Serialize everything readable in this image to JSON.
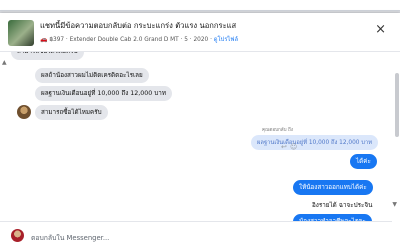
{
  "top_strip_text": "",
  "header": {
    "title": "แชทนี้มีข้อความตอบกลับต่อ กระบะแกร่ง ตัวแรง นอกกระแส",
    "car_marker": "🚗",
    "subtitle_main": "฿397 · Extender Double Cab 2.0 Grand D MT · ",
    "subtitle_dot": "5 · 2020 · ",
    "subtitle_link": "ดูโปรไฟล์",
    "close_symbol": "×"
  },
  "scroll": {
    "up": "▲",
    "down": "▼"
  },
  "messages": {
    "m0": "สามารถซื้อได้ไหมครับ",
    "m1": "ผลถ้าน้องสาวผมไม่ติดเครดิตอะไรเลย",
    "m2": "ผลฐานเงินเดือนอยู่ที่ 10,000 ถึง 12,000 บาท",
    "m3": "สามารถซื้อได้ไหมครับ",
    "reply_note": "คุณตอบกลับ ถึง",
    "quoted": "ผลฐานเงินเดือนอยู่ที่ 10,000 ถึง 12,000 บาท",
    "m4": "ได้ค่ะ",
    "m5": "ให้น้องสาวออกแทบได้ค่ะ",
    "m6": "อิงรายได้ ฉาจะประจิน",
    "m7": "น้องสาวทำอาชีพอะไรคะ"
  },
  "icons": {
    "reply": "↩",
    "emoji": "☺"
  },
  "composer": {
    "placeholder": "ตอบกลับใน Messenger..."
  },
  "colors": {
    "outgoing": "#1877f2",
    "incoming": "#e4e6eb",
    "link": "#1877f2"
  }
}
